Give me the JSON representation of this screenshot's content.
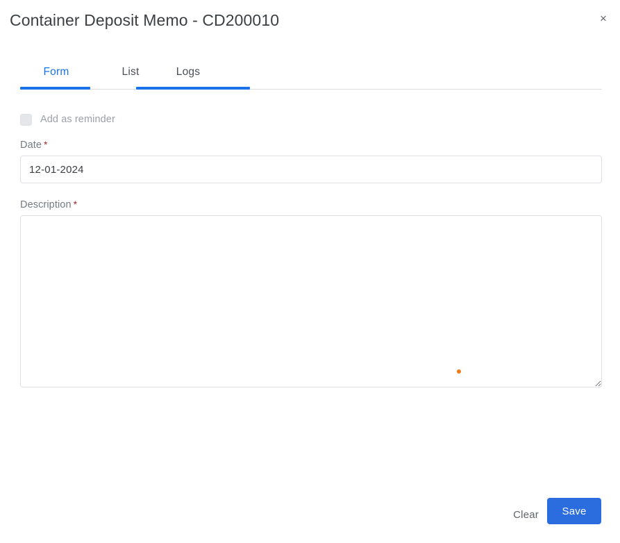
{
  "dialog": {
    "title": "Container Deposit Memo - CD200010",
    "close_label": "×"
  },
  "tabs": [
    {
      "id": "form",
      "label": "Form",
      "active": true
    },
    {
      "id": "list",
      "label": "List",
      "active": false
    },
    {
      "id": "logs",
      "label": "Logs",
      "active": false
    }
  ],
  "form": {
    "reminder": {
      "label": "Add as reminder",
      "checked": false,
      "disabled": true
    },
    "date": {
      "label": "Date",
      "required_marker": "*",
      "value": "12-01-2024",
      "placeholder": ""
    },
    "description": {
      "label": "Description",
      "required_marker": "*",
      "value": "",
      "placeholder": ""
    }
  },
  "footer": {
    "clear_label": "Clear",
    "save_label": "Save"
  },
  "colors": {
    "accent_blue": "#1a73e8",
    "save_button_blue": "#2b6cdf",
    "label_grey": "#747a80",
    "required_red": "#9c2b2b",
    "caret_orange": "#f07a14",
    "divider_grey": "#dadce0"
  }
}
